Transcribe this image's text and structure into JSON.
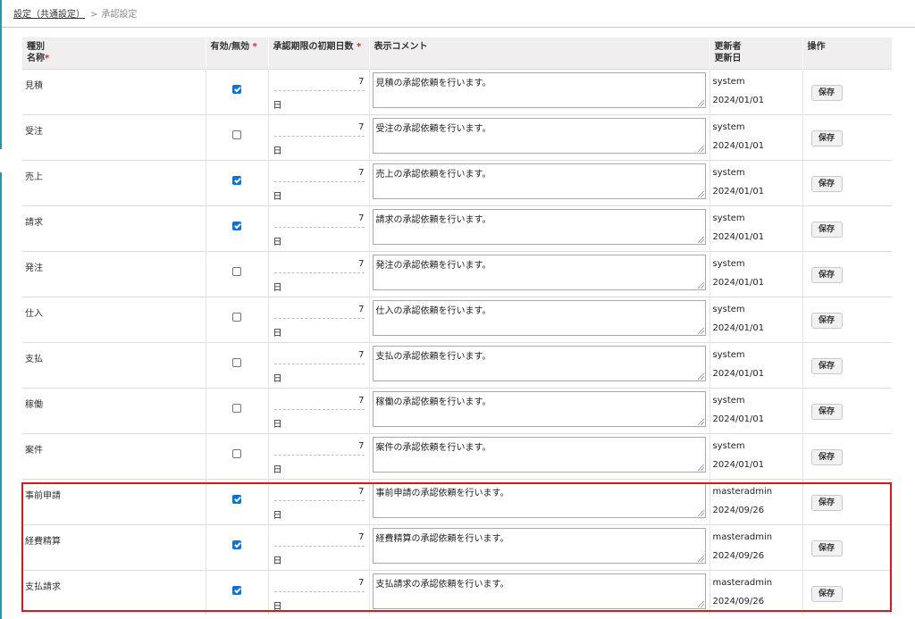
{
  "breadcrumb": {
    "parent": "設定（共通設定）",
    "separator": ">",
    "current": "承認設定"
  },
  "headers": {
    "type_line1": "種別",
    "type_line2": "名称",
    "enabled": "有効/無効",
    "days": "承認期限の初期日数",
    "comment": "表示コメント",
    "updated_line1": "更新者",
    "updated_line2": "更新日",
    "actions": "操作",
    "required_mark": "*"
  },
  "day_unit": "日",
  "save_label": "保存",
  "accent_colors": {
    "checkbox": "#0b73d6",
    "highlight": "#e0151b",
    "required": "#d9262c"
  },
  "rows": [
    {
      "name": "見積",
      "enabled": true,
      "days": "7",
      "comment": "見積の承認依頼を行います。",
      "updated_by": "system",
      "updated_on": "2024/01/01"
    },
    {
      "name": "受注",
      "enabled": false,
      "days": "7",
      "comment": "受注の承認依頼を行います。",
      "updated_by": "system",
      "updated_on": "2024/01/01"
    },
    {
      "name": "売上",
      "enabled": true,
      "days": "7",
      "comment": "売上の承認依頼を行います。",
      "updated_by": "system",
      "updated_on": "2024/01/01"
    },
    {
      "name": "請求",
      "enabled": true,
      "days": "7",
      "comment": "請求の承認依頼を行います。",
      "updated_by": "system",
      "updated_on": "2024/01/01"
    },
    {
      "name": "発注",
      "enabled": false,
      "days": "7",
      "comment": "発注の承認依頼を行います。",
      "updated_by": "system",
      "updated_on": "2024/01/01"
    },
    {
      "name": "仕入",
      "enabled": false,
      "days": "7",
      "comment": "仕入の承認依頼を行います。",
      "updated_by": "system",
      "updated_on": "2024/01/01"
    },
    {
      "name": "支払",
      "enabled": false,
      "days": "7",
      "comment": "支払の承認依頼を行います。",
      "updated_by": "system",
      "updated_on": "2024/01/01"
    },
    {
      "name": "稼働",
      "enabled": false,
      "days": "7",
      "comment": "稼働の承認依頼を行います。",
      "updated_by": "system",
      "updated_on": "2024/01/01"
    },
    {
      "name": "案件",
      "enabled": false,
      "days": "7",
      "comment": "案件の承認依頼を行います。",
      "updated_by": "system",
      "updated_on": "2024/01/01"
    },
    {
      "name": "事前申請",
      "enabled": true,
      "days": "7",
      "comment": "事前申請の承認依頼を行います。",
      "updated_by": "masteradmin",
      "updated_on": "2024/09/26"
    },
    {
      "name": "経費精算",
      "enabled": true,
      "days": "7",
      "comment": "経費精算の承認依頼を行います。",
      "updated_by": "masteradmin",
      "updated_on": "2024/09/26"
    },
    {
      "name": "支払請求",
      "enabled": true,
      "days": "7",
      "comment": "支払請求の承認依頼を行います。",
      "updated_by": "masteradmin",
      "updated_on": "2024/09/26"
    }
  ]
}
